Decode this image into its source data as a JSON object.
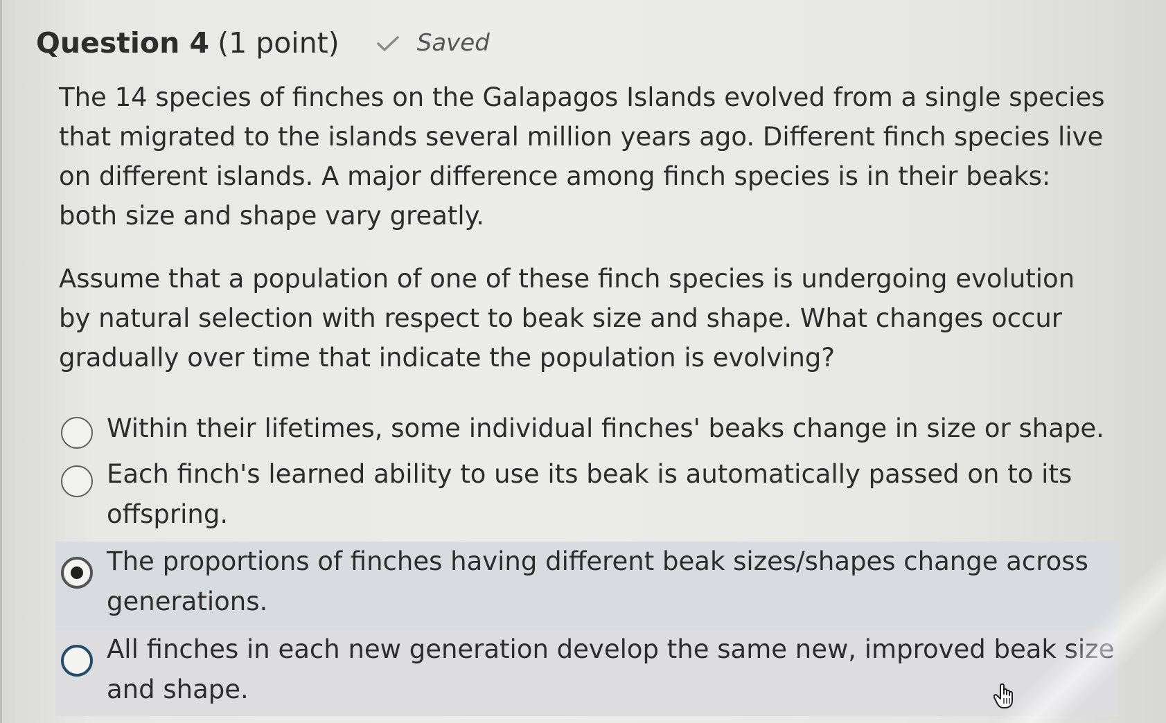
{
  "question": {
    "title": "Question 4",
    "points": "(1 point)",
    "status": "Saved",
    "prompt_paragraph_1": "The 14 species of finches on the Galapagos Islands evolved from a single species that migrated to the islands several million years ago. Different finch species live on different islands. A major difference among finch species is in their beaks: both size and shape vary greatly.",
    "prompt_paragraph_2": "Assume that a population of one of these finch species is undergoing evolution by natural selection with respect to beak size and shape. What changes occur gradually over time that indicate the population is evolving?"
  },
  "options": [
    {
      "label": "Within their lifetimes, some individual finches' beaks change in size or shape.",
      "selected": false
    },
    {
      "label": "Each finch's learned ability to use its beak is automatically passed on to its offspring.",
      "selected": false
    },
    {
      "label": "The proportions of finches having different beak sizes/shapes change across generations.",
      "selected": true
    },
    {
      "label": "All finches in each new generation develop the same new, improved beak size and shape.",
      "selected": false
    }
  ],
  "icons": {
    "saved": "checkmark-icon",
    "cursor": "hand-pointer-icon"
  },
  "colors": {
    "selected_background": "#d8dbdf",
    "focus_ring": "#244b68"
  }
}
